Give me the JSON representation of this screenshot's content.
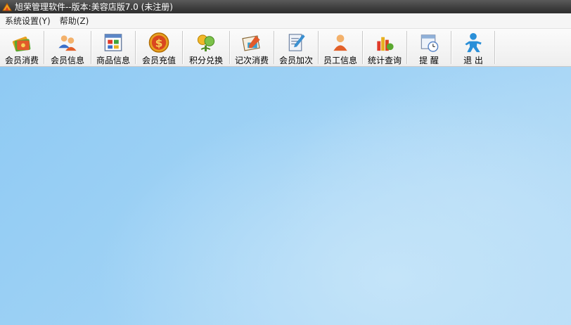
{
  "window": {
    "title": "旭荣管理软件--版本:美容店版7.0 (未注册)",
    "icon": "app-logo-icon"
  },
  "menu": [
    {
      "label": "系统设置(Y)"
    },
    {
      "label": "帮助(Z)"
    }
  ],
  "toolbar": {
    "buttons": [
      {
        "label": "会员消费",
        "icon": "member-consume-icon"
      },
      {
        "label": "会员信息",
        "icon": "member-info-icon"
      },
      {
        "label": "商品信息",
        "icon": "product-info-icon"
      },
      {
        "label": "会员充值",
        "icon": "member-recharge-icon"
      },
      {
        "label": "积分兑换",
        "icon": "points-exchange-icon"
      },
      {
        "label": "记次消费",
        "icon": "count-consume-icon"
      },
      {
        "label": "会员加次",
        "icon": "member-add-count-icon"
      },
      {
        "label": "员工信息",
        "icon": "employee-info-icon"
      },
      {
        "label": "统计查询",
        "icon": "statistics-query-icon"
      },
      {
        "label": "提 醒",
        "icon": "reminder-icon"
      },
      {
        "label": "退 出",
        "icon": "exit-icon"
      }
    ]
  },
  "colors": {
    "titlebar": "#3d3d3d",
    "workspace": "#9fd2f5"
  }
}
